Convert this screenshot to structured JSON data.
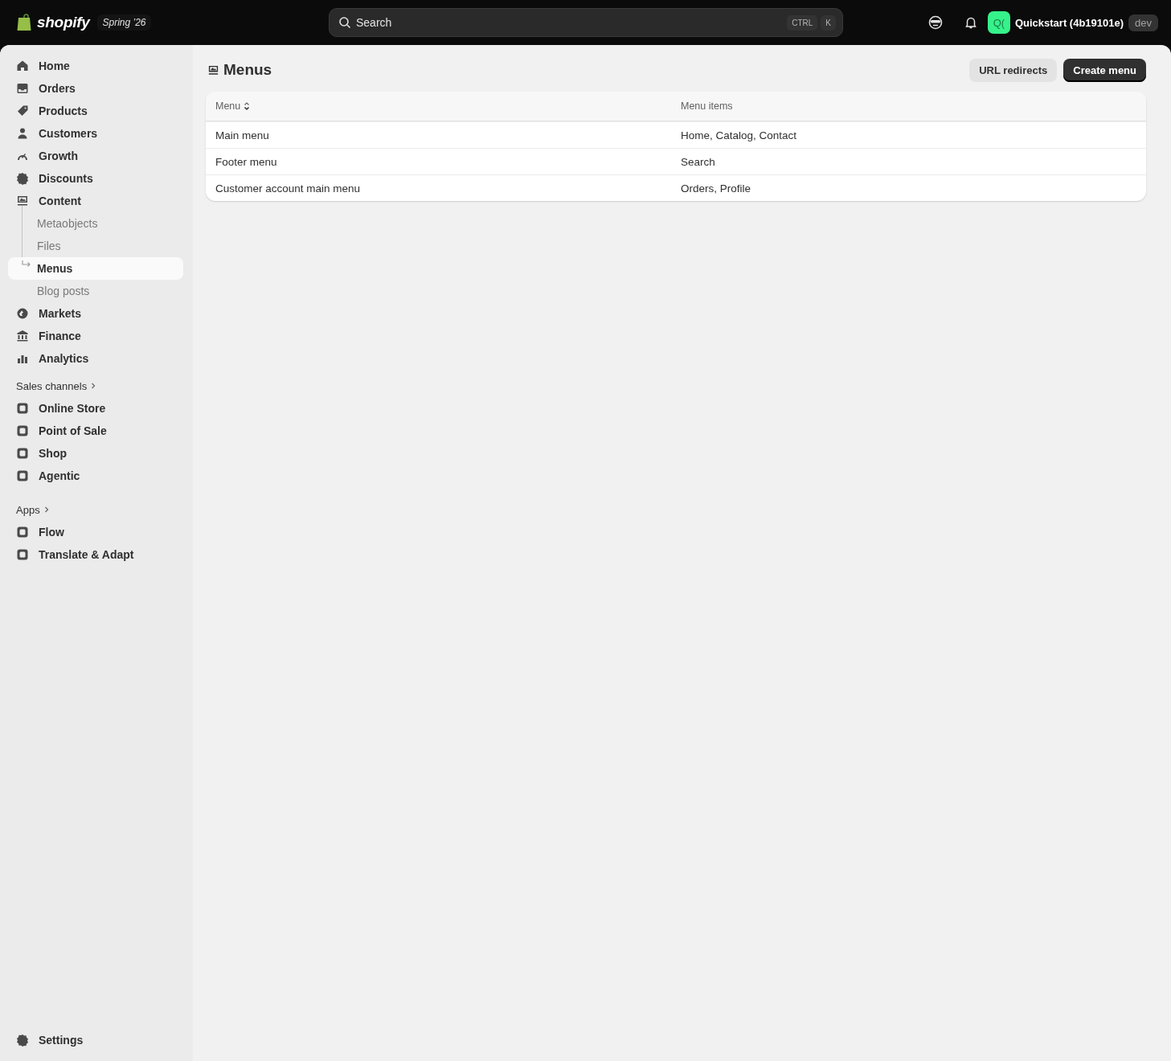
{
  "topbar": {
    "brand": "shopify",
    "edition": "Spring ’26",
    "search": {
      "placeholder": "Search",
      "keys": [
        "CTRL",
        "K"
      ]
    },
    "store": {
      "avatar": "Q(",
      "name": "Quickstart (4b19101e)",
      "badge": "dev"
    }
  },
  "sidebar": {
    "items": [
      {
        "label": "Home",
        "selected": false
      },
      {
        "label": "Orders",
        "selected": false
      },
      {
        "label": "Products",
        "selected": false
      },
      {
        "label": "Customers",
        "selected": false
      },
      {
        "label": "Growth",
        "selected": false
      },
      {
        "label": "Discounts",
        "selected": false
      },
      {
        "label": "Content",
        "selected": false,
        "children": [
          {
            "label": "Metaobjects",
            "selected": false
          },
          {
            "label": "Files",
            "selected": false
          },
          {
            "label": "Menus",
            "selected": true
          },
          {
            "label": "Blog posts",
            "selected": false
          }
        ]
      },
      {
        "label": "Markets",
        "selected": false
      },
      {
        "label": "Finance",
        "selected": false
      },
      {
        "label": "Analytics",
        "selected": false
      }
    ],
    "groups": [
      {
        "title": "Sales channels",
        "items": [
          {
            "label": "Online Store",
            "selected": false
          },
          {
            "label": "Point of Sale",
            "selected": false
          },
          {
            "label": "Shop",
            "selected": false
          },
          {
            "label": "Agentic",
            "selected": false
          }
        ]
      },
      {
        "title": "Apps",
        "items": [
          {
            "label": "Flow",
            "selected": false
          },
          {
            "label": "Translate & Adapt",
            "selected": false
          }
        ]
      }
    ],
    "settings": {
      "label": "Settings",
      "selected": false
    }
  },
  "page": {
    "title": "Menus",
    "actions": [
      {
        "label": "URL redirects",
        "kind": "secondary"
      },
      {
        "label": "Create menu",
        "kind": "primary"
      }
    ]
  },
  "table": {
    "columns": [
      {
        "label": "Menu",
        "sortable": true
      },
      {
        "label": "Menu items",
        "sortable": false
      }
    ],
    "rows": [
      [
        "Main menu",
        "Home, Catalog, Contact"
      ],
      [
        "Footer menu",
        "Search"
      ],
      [
        "Customer account main menu",
        "Orders, Profile"
      ]
    ]
  }
}
